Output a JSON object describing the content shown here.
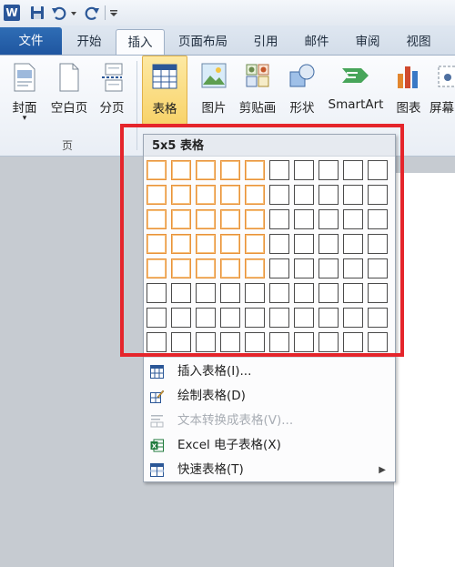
{
  "ribbon_tabs": [
    "文件",
    "开始",
    "插入",
    "页面布局",
    "引用",
    "邮件",
    "审阅",
    "视图"
  ],
  "active_tab": "插入",
  "ribbon": {
    "cover": "封面",
    "blank_page": "空白页",
    "page_break": "分页",
    "table": "表格",
    "picture": "图片",
    "clipart": "剪贴画",
    "shapes": "形状",
    "smartart": "SmartArt",
    "chart": "图表",
    "screenshot": "屏幕",
    "group_pages": "页"
  },
  "dropdown": {
    "grid_title": "5x5 表格",
    "grid_rows": 8,
    "grid_cols": 10,
    "selected_rows": 5,
    "selected_cols": 5,
    "menu": [
      {
        "label": "插入表格(I)...",
        "enabled": true,
        "icon": "insert-table-icon"
      },
      {
        "label": "绘制表格(D)",
        "enabled": true,
        "icon": "draw-table-icon"
      },
      {
        "label": "文本转换成表格(V)...",
        "enabled": false,
        "icon": "convert-text-icon"
      },
      {
        "label": "Excel 电子表格(X)",
        "enabled": true,
        "icon": "excel-icon"
      },
      {
        "label": "快速表格(T)",
        "enabled": true,
        "icon": "quick-table-icon",
        "submenu": true
      }
    ]
  },
  "colors": {
    "file_tab": "#2f6db5",
    "highlight": "#f8d36a",
    "selected_cell_border": "#e8923a",
    "annotation": "#e5252b"
  }
}
